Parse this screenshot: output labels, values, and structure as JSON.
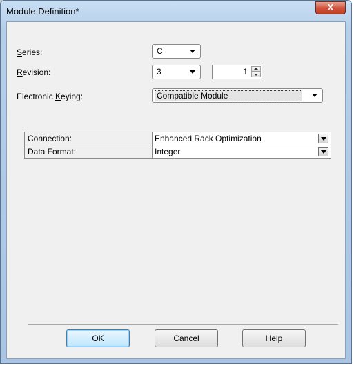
{
  "window": {
    "title": "Module Definition*",
    "close_label": "X"
  },
  "fields": {
    "series": {
      "label_pre": "",
      "label_u": "S",
      "label_post": "eries:",
      "value": "C"
    },
    "revision": {
      "label_pre": "",
      "label_u": "R",
      "label_post": "evision:",
      "major": "3",
      "minor": "1"
    },
    "keying": {
      "label_pre": "Electronic ",
      "label_u": "K",
      "label_post": "eying:",
      "value": "Compatible Module"
    }
  },
  "grid": {
    "rows": [
      {
        "name": "Connection:",
        "value": "Enhanced Rack Optimization"
      },
      {
        "name": "Data Format:",
        "value": "Integer"
      }
    ]
  },
  "buttons": {
    "ok": "OK",
    "cancel": "Cancel",
    "help": "Help"
  }
}
